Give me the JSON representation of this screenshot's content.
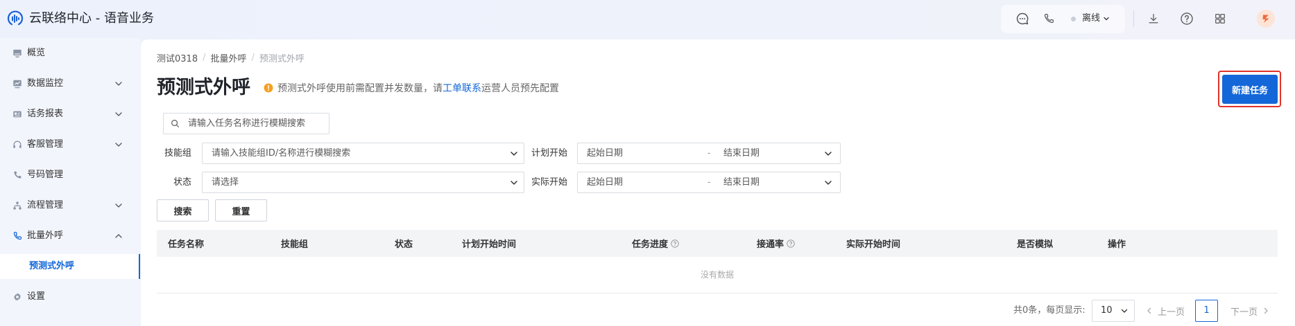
{
  "app": {
    "title": "云联络中心 - 语音业务",
    "logo_icon": "voice-wave-logo-icon"
  },
  "header": {
    "agent_status": "离线",
    "icons": [
      "chat-icon",
      "phone-icon",
      "chevron-down-icon",
      "download-icon",
      "help-icon",
      "apps-grid-icon",
      "user-avatar"
    ]
  },
  "sidebar": {
    "items": [
      {
        "label": "概览",
        "icon": "overview-icon",
        "expandable": false
      },
      {
        "label": "数据监控",
        "icon": "data-monitor-icon",
        "expandable": true,
        "expanded": false
      },
      {
        "label": "话务报表",
        "icon": "report-icon",
        "expandable": true,
        "expanded": false
      },
      {
        "label": "客服管理",
        "icon": "headset-icon",
        "expandable": true,
        "expanded": false
      },
      {
        "label": "号码管理",
        "icon": "phone-number-icon",
        "expandable": false
      },
      {
        "label": "流程管理",
        "icon": "flow-icon",
        "expandable": true,
        "expanded": false
      },
      {
        "label": "批量外呼",
        "icon": "outbound-call-icon",
        "expandable": true,
        "expanded": true,
        "children": [
          {
            "label": "预测式外呼",
            "selected": true
          }
        ]
      },
      {
        "label": "设置",
        "icon": "gear-icon",
        "expandable": false
      }
    ]
  },
  "breadcrumb": {
    "items": [
      "测试0318",
      "批量外呼",
      "预测式外呼"
    ],
    "separator": "/"
  },
  "page": {
    "title": "预测式外呼",
    "notice": {
      "icon": "info-icon",
      "text_before": "预测式外呼使用前需配置并发数量，请",
      "link": "工单联系",
      "text_after": "运营人员预先配置"
    },
    "new_task_button": "新建任务"
  },
  "search": {
    "placeholder": "请输入任务名称进行模糊搜索",
    "icon": "search-icon"
  },
  "filters": {
    "skill_group": {
      "label": "技能组",
      "placeholder": "请输入技能组ID/名称进行模糊搜索"
    },
    "plan_start": {
      "label": "计划开始",
      "start_placeholder": "起始日期",
      "separator": "-",
      "end_placeholder": "结束日期"
    },
    "status": {
      "label": "状态",
      "placeholder": "请选择"
    },
    "actual_start": {
      "label": "实际开始",
      "start_placeholder": "起始日期",
      "separator": "-",
      "end_placeholder": "结束日期"
    },
    "search_button": "搜索",
    "reset_button": "重置"
  },
  "table": {
    "columns": [
      {
        "label": "任务名称"
      },
      {
        "label": "技能组"
      },
      {
        "label": "状态"
      },
      {
        "label": "计划开始时间"
      },
      {
        "label": "任务进度",
        "help": true
      },
      {
        "label": "接通率",
        "help": true
      },
      {
        "label": "实际开始时间"
      },
      {
        "label": "是否模拟"
      },
      {
        "label": "操作"
      }
    ],
    "rows": [],
    "empty_text": "没有数据"
  },
  "pagination": {
    "total_text": "共0条，每页显示:",
    "page_size": "10",
    "prev": "上一页",
    "current_page": "1",
    "next": "下一页"
  },
  "colors": {
    "primary": "#1467d8",
    "link": "#1467d8",
    "warning": "#f5a01e",
    "highlight": "#e0332a",
    "header_bg": "#eef2fb",
    "sidebar_bg": "#f2f5fc"
  }
}
